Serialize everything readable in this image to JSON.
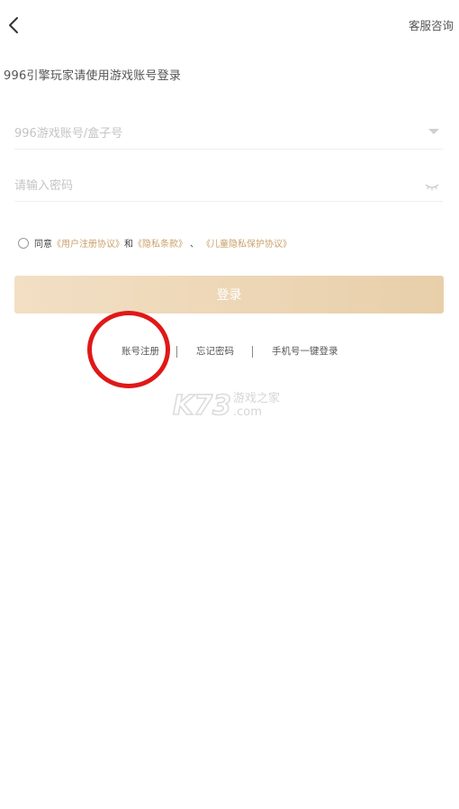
{
  "header": {
    "service_label": "客服咨询"
  },
  "subtitle": "996引擎玩家请使用游戏账号登录",
  "form": {
    "account_placeholder": "996游戏账号/盒子号",
    "password_placeholder": "请输入密码"
  },
  "agreement": {
    "prefix": "同意",
    "user_agreement": "《用户注册协议》",
    "conj": "和",
    "privacy": "《隐私条款》",
    "sep": "、",
    "child_privacy": "《儿童隐私保护协议》"
  },
  "login_label": "登录",
  "links": {
    "register": "账号注册",
    "forgot": "忘记密码",
    "phone_login": "手机号一键登录"
  },
  "watermark": {
    "brand": "K73",
    "cn": "游戏之家",
    "domain": ".com"
  },
  "colors": {
    "accent_gold": "#c9a16a",
    "button_gradient_start": "#f2dfc4",
    "button_gradient_end": "#e8cfaa",
    "annotation_red": "#e01818"
  }
}
